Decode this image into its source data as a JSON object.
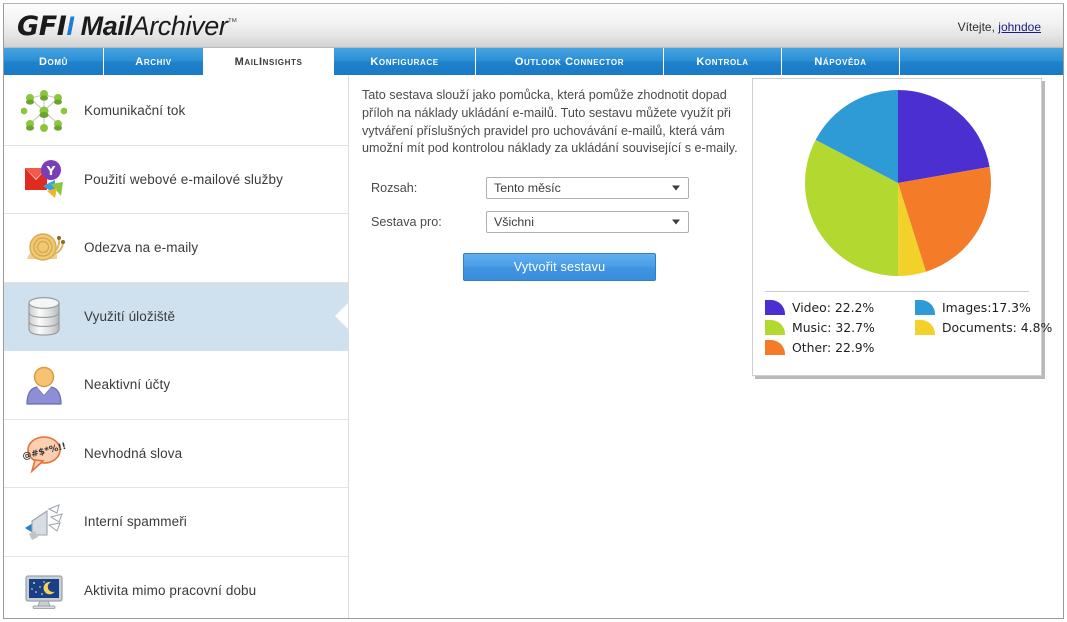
{
  "app": {
    "brand_gfi": "GFI",
    "brand_mail": "Mail",
    "brand_archiver": "Archiver",
    "trademark": "™",
    "accent_blue": "#1a7fd4"
  },
  "header": {
    "welcome_text": "Vítejte,",
    "username": "johndoe"
  },
  "tabs": [
    {
      "label": "Domů",
      "active": false
    },
    {
      "label": "Archiv",
      "active": false
    },
    {
      "label": "MailInsights",
      "active": true
    },
    {
      "label": "Konfigurace",
      "active": false
    },
    {
      "label": "Outlook Connector",
      "active": false
    },
    {
      "label": "Kontrola",
      "active": false
    },
    {
      "label": "Nápověda",
      "active": false
    }
  ],
  "sidebar": {
    "items": [
      {
        "label": "Komunikační tok",
        "icon": "network-people-icon",
        "selected": false
      },
      {
        "label": "Použití webové e-mailové služby",
        "icon": "webmail-services-icon",
        "selected": false
      },
      {
        "label": "Odezva na e-maily",
        "icon": "snail-icon",
        "selected": false
      },
      {
        "label": "Využití úložiště",
        "icon": "database-icon",
        "selected": true
      },
      {
        "label": "Neaktivní účty",
        "icon": "user-icon",
        "selected": false
      },
      {
        "label": "Nevhodná slova",
        "icon": "speech-bubble-icon",
        "selected": false
      },
      {
        "label": "Interní spammeři",
        "icon": "megaphone-icon",
        "selected": false
      },
      {
        "label": "Aktivita mimo pracovní dobu",
        "icon": "night-monitor-icon",
        "selected": false
      }
    ]
  },
  "main": {
    "description": "Tato sestava slouží jako pomůcka, která pomůže zhodnotit dopad příloh na náklady ukládání e-mailů. Tuto sestavu můžete využít při vytváření příslušných pravidel pro uchovávání e-mailů, která vám umožní mít pod kontrolou náklady za ukládání související s e-maily.",
    "form": {
      "range_label": "Rozsah:",
      "range_value": "Tento měsíc",
      "report_for_label": "Sestava pro:",
      "report_for_value": "Všichni",
      "submit_label": "Vytvořit sestavu"
    }
  },
  "chart_data": {
    "type": "pie",
    "title": "",
    "legend_position": "bottom",
    "categories": [
      "Video",
      "Music",
      "Other",
      "Images",
      "Documents"
    ],
    "values": [
      22.2,
      32.7,
      22.9,
      17.3,
      4.8
    ],
    "unit": "%",
    "colors": [
      "#4B2FD0",
      "#B3D930",
      "#F47B28",
      "#2E9BD6",
      "#F2D22A"
    ],
    "legend_entries": [
      {
        "label": "Video: 22.2%",
        "color": "#4B2FD0"
      },
      {
        "label": "Images:17.3%",
        "color": "#2E9BD6"
      },
      {
        "label": "Music: 32.7%",
        "color": "#B3D930"
      },
      {
        "label": "Documents: 4.8%",
        "color": "#F2D22A"
      },
      {
        "label": "Other: 22.9%",
        "color": "#F47B28"
      }
    ],
    "legend_order": [
      "Video: 22.2%",
      "Images:17.3%",
      "Music: 32.7%",
      "Documents: 4.8%",
      "Other: 22.9%"
    ]
  }
}
